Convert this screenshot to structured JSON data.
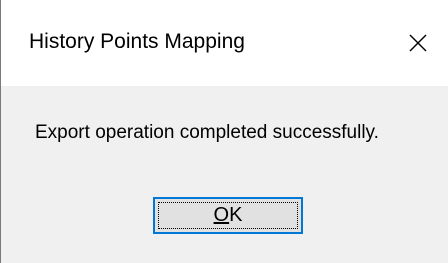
{
  "dialog": {
    "title": "History Points Mapping",
    "close_icon": "close-icon",
    "message": "Export operation completed successfully.",
    "ok_button": {
      "mnemonic": "O",
      "rest": "K"
    }
  },
  "colors": {
    "titlebar_bg": "#ffffff",
    "body_bg": "#f0f0f0",
    "button_bg": "#e1e1e1",
    "button_focus_border": "#0078d7"
  }
}
